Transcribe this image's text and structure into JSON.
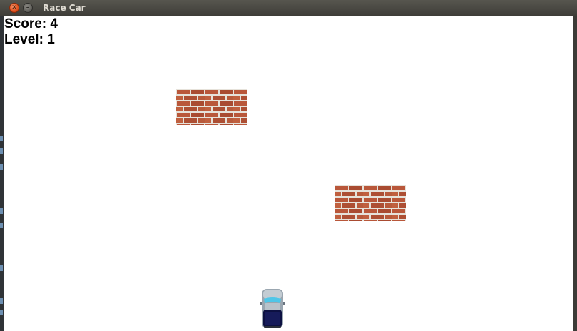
{
  "window": {
    "title": "Race Car",
    "close_icon": "close-icon",
    "minimize_icon": "minimize-icon"
  },
  "hud": {
    "score_label": "Score: 4",
    "level_label": "Level: 1"
  },
  "game": {
    "score": 4,
    "level": 1,
    "background_color": "#ffffff",
    "obstacles": [
      {
        "type": "brick-wall"
      },
      {
        "type": "brick-wall"
      }
    ],
    "player": {
      "type": "car",
      "body_color": "#0d1142",
      "roof_color": "#aab8c2"
    }
  },
  "colors": {
    "brick": "#b5553a",
    "mortar": "#e8e4dc",
    "titlebar": "#3e3d38",
    "close_button": "#e0521f"
  }
}
